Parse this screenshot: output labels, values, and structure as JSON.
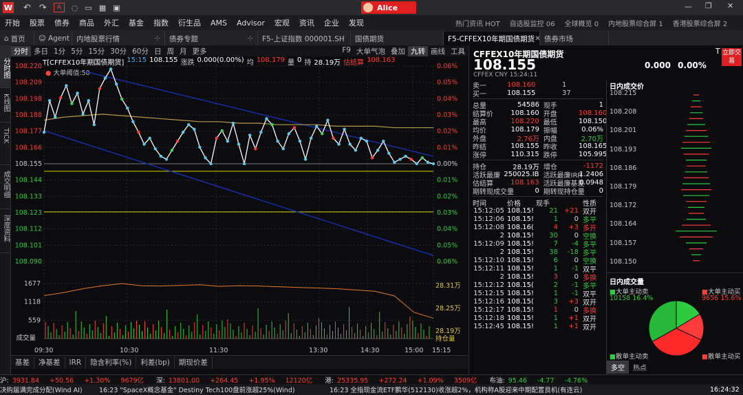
{
  "topbar": {
    "logo": "W",
    "user": "Alice"
  },
  "menu": [
    "开始",
    "股票",
    "债券",
    "商品",
    "外汇",
    "基金",
    "指数",
    "衍生品",
    "AMS",
    "Advisor",
    "宏观",
    "资讯",
    "企业",
    "发现"
  ],
  "menu_right": [
    "热门资讯 HOT",
    "自选股监控 06",
    "全球概览 0",
    "内地股票综合屏 1",
    "香港股票综合屏 2"
  ],
  "tabs": [
    {
      "label": "首页"
    },
    {
      "label": "Agent"
    },
    {
      "label": "内地股票行情"
    },
    {
      "label": "债券专题"
    },
    {
      "label": "F5-上证指数 000001.SH"
    },
    {
      "label": "国债期货"
    },
    {
      "label": "F5-CFFEX10年期国债期货"
    },
    {
      "label": "债券市场"
    }
  ],
  "left_tabs": [
    "分时图",
    "K线图",
    "TICK",
    "成交明细",
    "深度资料"
  ],
  "chart_toolbar": {
    "left": [
      "分时",
      "多日",
      "1分",
      "5分",
      "15分",
      "30分",
      "60分",
      "日",
      "周",
      "月",
      "更多"
    ],
    "right": [
      "F9",
      "大单气泡",
      "叠加",
      "九转",
      "画线",
      "工具"
    ]
  },
  "info_line": {
    "name": "T[CFFEX10年期国债期货]",
    "time": "15:15",
    "price": "108.155",
    "chg_label": "涨跌",
    "chg": "0.000(0.00%)",
    "avg_label": "均",
    "avg": "108.179",
    "vol_label": "量",
    "vol": "0",
    "hold_label": "持",
    "hold": "28.19万",
    "settle_label": "估结算",
    "settle": "108.163"
  },
  "legend_label": "大单阈值:50",
  "chart_data": {
    "type": "line",
    "x_ticks": [
      "09:30",
      "10:30",
      "11:30",
      "13:30",
      "14:30",
      "15:00",
      "15:15"
    ],
    "price_ticks": [
      "108.220",
      "108.209",
      "108.198",
      "108.188",
      "108.177",
      "108.166",
      "108.155",
      "108.144",
      "108.133",
      "108.123",
      "108.112",
      "108.101",
      "108.090"
    ],
    "pct_ticks": [
      "0.06%",
      "0.05%",
      "0.04%",
      "0.03%",
      "0.02%",
      "0.01%",
      "0.00%",
      "0.01%",
      "0.02%",
      "0.03%",
      "0.04%",
      "0.05%",
      "0.06%"
    ],
    "vol_ticks": [
      "1677",
      "1118",
      "559"
    ],
    "vol_label": "成交量",
    "hold_ticks": [
      "28.31万",
      "28.25万",
      "28.19万"
    ],
    "hold_label": "持仓量",
    "prev_close": 108.155,
    "price": [
      108.176,
      108.197,
      108.186,
      108.199,
      108.207,
      108.195,
      108.202,
      108.188,
      108.197,
      108.181,
      108.205,
      108.212,
      108.218,
      108.208,
      108.198,
      108.192,
      108.183,
      108.176,
      108.168,
      108.172,
      108.165,
      108.16,
      108.158,
      108.164,
      108.17,
      108.176,
      108.181,
      108.178,
      108.166,
      108.159,
      108.155,
      108.172,
      108.177,
      108.17,
      108.182,
      108.168,
      108.155,
      108.174,
      108.165,
      108.176,
      108.185,
      108.181,
      108.17,
      108.165,
      108.175,
      108.179,
      108.17,
      108.158,
      108.172,
      108.18,
      108.175,
      108.184,
      108.172,
      108.168,
      108.178,
      108.168,
      108.164,
      108.172,
      108.17,
      108.159,
      108.164,
      108.17,
      108.162,
      108.156,
      108.158,
      108.16,
      108.158,
      108.155,
      108.159,
      108.156,
      108.155
    ],
    "avg_line": [
      108.184,
      108.186,
      108.187,
      108.188,
      108.187,
      108.186,
      108.185,
      108.184,
      108.183,
      108.183,
      108.182,
      108.182,
      108.181,
      108.181,
      108.181,
      108.18,
      108.18,
      108.18,
      108.179,
      108.179,
      108.179
    ],
    "volume": [
      1310,
      1400,
      1520,
      1610,
      1677,
      1610,
      1600,
      1620,
      1640,
      1590,
      1610,
      1600,
      1580,
      1560,
      1540,
      1520,
      1480,
      1440,
      1300,
      800,
      620
    ],
    "hold": [
      28.31,
      28.3,
      28.31,
      28.3,
      28.29,
      28.28,
      28.27,
      28.26,
      28.25,
      28.24,
      28.24,
      28.23,
      28.22,
      28.21,
      28.2,
      28.2,
      28.19
    ]
  },
  "bottom_tabs": [
    "基差",
    "净基差",
    "IRR",
    "隐含利率(%)",
    "利差(bp)",
    "期现价差"
  ],
  "quote": {
    "title": "CFFEX10年期国债期货",
    "code_suffix": "T",
    "price": "108.155",
    "exch": "CFFEX",
    "cur": "CNY",
    "time": "15:24:11",
    "chg": "0.000",
    "pct": "0.00%",
    "btn": "立即交易",
    "sell_label": "卖一",
    "sell_price": "108.160",
    "sell_vol": "1",
    "buy_label": "买一",
    "buy_price": "108.155",
    "buy_vol": "37",
    "stats": [
      [
        "总量",
        "54586",
        "现手",
        "1"
      ],
      [
        "结算价",
        "108.160",
        "开盘",
        "108.160"
      ],
      [
        "最高",
        "108.220",
        "最低",
        "108.150"
      ],
      [
        "均价",
        "108.179",
        "振幅",
        "0.06%"
      ],
      [
        "外盘",
        "2.76万",
        "内盘",
        "2.70万"
      ],
      [
        "昨结",
        "108.155",
        "昨收",
        "108.165"
      ],
      [
        "涨停",
        "110.315",
        "跌停",
        "105.995"
      ]
    ],
    "stats2": [
      [
        "持仓",
        "28.19万",
        "增仓",
        "-1172"
      ],
      [
        "活跃最廉",
        "250025.IB",
        "活跃最廉IRR",
        "1.2406"
      ],
      [
        "估结算",
        "108.163",
        "活跃最廉基差",
        "0.0948"
      ],
      [
        "期转现成交量",
        "0",
        "期转现持仓量",
        "0"
      ]
    ],
    "trade_header": [
      "时间",
      "价格",
      "现手",
      "",
      "性质"
    ],
    "trades": [
      [
        "15:12:05",
        "108.15!",
        "21",
        "+21",
        "双开"
      ],
      [
        "15:12:06",
        "108.15!",
        "1",
        "0",
        "多平"
      ],
      [
        "15:12:08",
        "108.16(",
        "4",
        "+3",
        "多开"
      ],
      [
        "2",
        "108.15!",
        "30",
        "0",
        "空换"
      ],
      [
        "15:12:09",
        "108.15!",
        "7",
        "-4",
        "多平"
      ],
      [
        "2",
        "108.15!",
        "38",
        "-18",
        "多平"
      ],
      [
        "15:12:10",
        "108.15!",
        "6",
        "0",
        "空换"
      ],
      [
        "15:12:11",
        "108.15!",
        "1",
        "-1",
        "双平"
      ],
      [
        "2",
        "108.15!",
        "3",
        "0",
        "多换"
      ],
      [
        "15:12:12",
        "108.15(",
        "2",
        "-1",
        "多平"
      ],
      [
        "15:12:15",
        "108.15!",
        "1",
        "-1",
        "双平"
      ],
      [
        "15:12:16",
        "108.15(",
        "3",
        "+3",
        "双开"
      ],
      [
        "15:12:17",
        "108.15!",
        "1",
        "0",
        "多换"
      ],
      [
        "15:12:18",
        "108.15!",
        "1",
        "+1",
        "双开"
      ],
      [
        "15:12:45",
        "108.15!",
        "1",
        "+1",
        "双开"
      ]
    ]
  },
  "right_panel": {
    "title1": "日内成交价",
    "price_ticks": [
      "108.215",
      "108.208",
      "108.201",
      "108.193",
      "108.186",
      "108.179",
      "108.172",
      "108.164",
      "108.157",
      "108.150"
    ],
    "title2": "日内成交量",
    "big_sell": "大单主动卖",
    "big_buy": "大单主动买",
    "big_sell_val": "10158",
    "big_sell_pct": "16.4%",
    "big_buy_val": "9656",
    "big_buy_pct": "15.6%",
    "small_sell": "散单主动卖",
    "small_buy": "散单主动买",
    "tabs": [
      "多空",
      "热点"
    ]
  },
  "ticker": [
    [
      "沪:",
      "3931.84",
      "+50.56",
      "+1.30%",
      "9679亿"
    ],
    [
      "深:",
      "13801.00",
      "+264.45",
      "+1.95%",
      "12120亿"
    ],
    [
      "港:",
      "25335.95",
      "+272.24",
      "+1.09%",
      "3509亿"
    ],
    [
      "布油:",
      "95.46",
      "-4.77",
      "-4.76%",
      ""
    ]
  ],
  "news": {
    "left": "决购届满完成分配(Wind AI)",
    "items": [
      "16:23   \"SpaceX概念基金\" Destiny Tech100盘前涨超25%(Wind)",
      "16:23   全指现金流ETF鹏华(512130)收涨超2%，机构称A股迎来中期配置良机(有连云)"
    ],
    "time": "16:24:32"
  }
}
